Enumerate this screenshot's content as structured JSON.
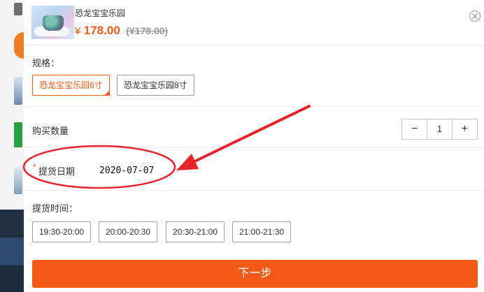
{
  "product": {
    "name": "恐龙宝宝乐园",
    "currency_symbol": "¥",
    "price": "178.00",
    "original_price": "(¥178.00)"
  },
  "spec": {
    "label": "规格：",
    "options": [
      "恐龙宝宝乐园6寸",
      "恐龙宝宝乐园8寸"
    ],
    "selected_index": 0
  },
  "quantity": {
    "label": "购买数量",
    "minus": "−",
    "value": "1",
    "plus": "+"
  },
  "pickup_date": {
    "required_mark": "*",
    "label": "提货日期",
    "value": "2020-07-07"
  },
  "pickup_time": {
    "label": "提货时间：",
    "slots": [
      "19:30-20:00",
      "20:00-20:30",
      "20:30-21:00",
      "21:00-21:30"
    ]
  },
  "next_button": {
    "label": "下一步"
  },
  "colors": {
    "accent": "#f25a15",
    "annotation": "#e8232a"
  },
  "icons": {
    "close": "close-circle-icon"
  }
}
